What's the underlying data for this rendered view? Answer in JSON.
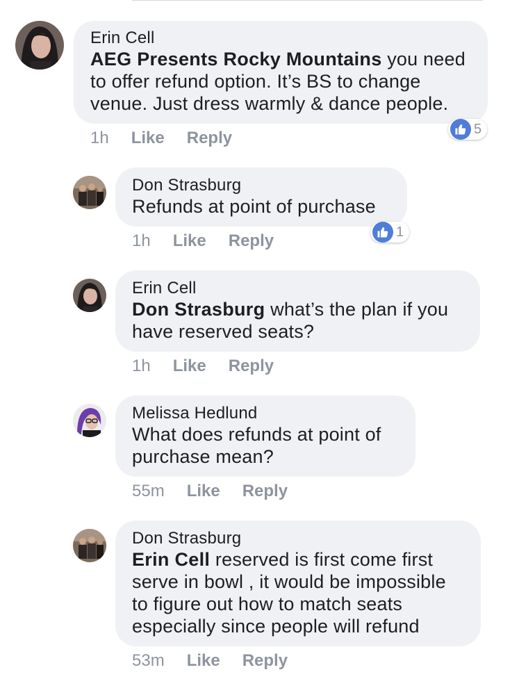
{
  "comments": [
    {
      "author": "Erin Cell",
      "mention": "AEG Presents Rocky Mountains",
      "text": " you need to offer refund option. It’s BS to change venue. Just dress warmly & dance people.",
      "time": "1h",
      "like_label": "Like",
      "reply_label": "Reply",
      "reactions": "5"
    },
    {
      "author": "Don Strasburg",
      "mention": "",
      "text": "Refunds at point of purchase",
      "time": "1h",
      "like_label": "Like",
      "reply_label": "Reply",
      "reactions": "1"
    },
    {
      "author": "Erin Cell",
      "mention": "Don Strasburg",
      "text": " what’s the plan if you have reserved seats?",
      "time": "1h",
      "like_label": "Like",
      "reply_label": "Reply"
    },
    {
      "author": "Melissa Hedlund",
      "mention": "",
      "text": "What does refunds at point of purchase mean?",
      "time": "55m",
      "like_label": "Like",
      "reply_label": "Reply"
    },
    {
      "author": "Don Strasburg",
      "mention": "Erin Cell",
      "text": " reserved is first come first serve in bowl , it would be impossible to figure out how to match seats especially since people will refund",
      "time": "53m",
      "like_label": "Like",
      "reply_label": "Reply"
    }
  ],
  "colors": {
    "bubble": "#f0f1f4",
    "meta_text": "#8d949e",
    "like_blue": "#4f7dd8"
  },
  "icons": {
    "reaction": "thumbs-up-icon"
  }
}
